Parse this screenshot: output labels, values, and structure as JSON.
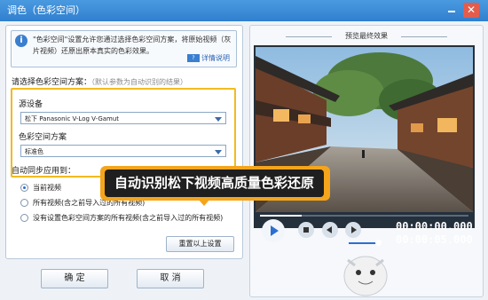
{
  "window": {
    "title": "调色（色彩空间）"
  },
  "info": {
    "text": "\"色彩空间\"设置允许您通过选择色彩空间方案，将原始视频（灰片视频）还原出原本真实的色彩效果。",
    "help_label": "详情说明"
  },
  "colorspace": {
    "section_label": "请选择色彩空间方案：",
    "section_hint": "（默认参数为自动识别的结果）",
    "source_label": "源设备",
    "source_value": "松下 Panasonic V-Log V-Gamut",
    "scheme_label": "色彩空间方案",
    "scheme_value": "标准色"
  },
  "sync": {
    "label": "自动同步应用到：",
    "options": [
      {
        "label": "当前视频",
        "selected": true
      },
      {
        "label": "所有视频(含之前导入过的所有视频)",
        "selected": false
      },
      {
        "label": "没有设置色彩空间方案的所有视频(含之前导入过的所有视频)",
        "selected": false
      }
    ],
    "reset_label": "重置以上设置"
  },
  "buttons": {
    "ok": "确 定",
    "cancel": "取 消"
  },
  "preview": {
    "title": "预览最终效果",
    "time_current": "00:00:00.000",
    "time_total": "00:00:05.000",
    "progress_fraction": 0.2,
    "volume_fraction": 0.85
  },
  "banner": {
    "text": "自动识别松下视频高质量色彩还原"
  },
  "colors": {
    "titlebar": "#3a8ad8",
    "highlight": "#f2bb1f",
    "banner": "#f4a51c",
    "accent": "#2d6fd0"
  }
}
